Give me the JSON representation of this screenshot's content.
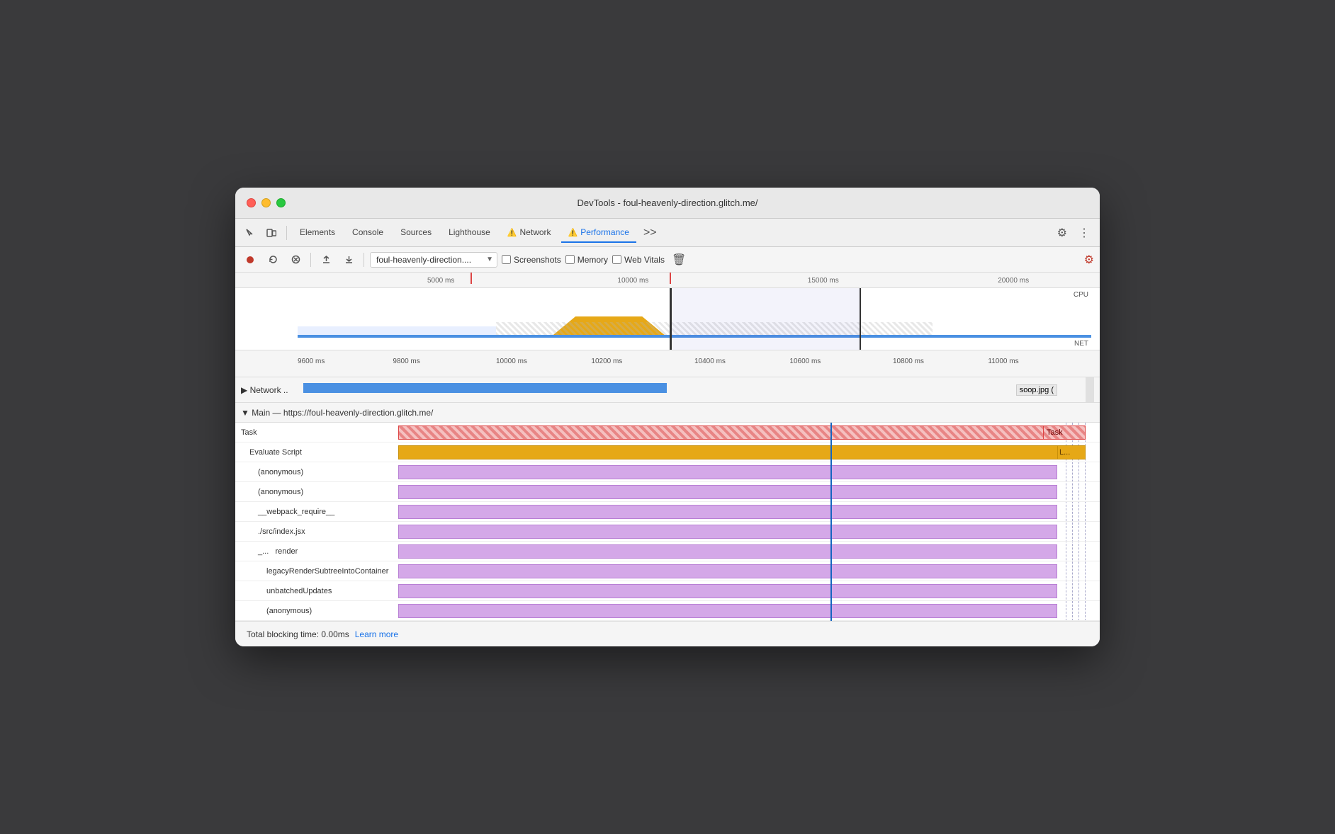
{
  "window": {
    "title": "DevTools - foul-heavenly-direction.glitch.me/"
  },
  "tabs": {
    "elements": "Elements",
    "console": "Console",
    "sources": "Sources",
    "lighthouse": "Lighthouse",
    "network": "Network",
    "performance": "Performance",
    "more": ">>"
  },
  "toolbar": {
    "url_value": "foul-heavenly-direction....",
    "screenshots_label": "Screenshots",
    "memory_label": "Memory",
    "web_vitals_label": "Web Vitals"
  },
  "timeline": {
    "ruler_marks": [
      "5000 ms",
      "10000 ms",
      "15000 ms",
      "20000 ms"
    ],
    "lower_marks": [
      "9600 ms",
      "9800 ms",
      "10000 ms",
      "10200 ms",
      "10400 ms",
      "10600 ms",
      "10800 ms",
      "11000 ms"
    ],
    "cpu_label": "CPU",
    "net_label": "NET"
  },
  "network_row": {
    "label": "▶ Network ..",
    "soop_label": "soop.jpg ("
  },
  "main_section": {
    "header": "▼ Main — https://foul-heavenly-direction.glitch.me/",
    "rows": [
      {
        "label": "Task",
        "bar_type": "task",
        "bar_right_label": "Task"
      },
      {
        "label": "Evaluate Script",
        "bar_type": "evaluate",
        "bar_right_label": "L..."
      },
      {
        "label": "(anonymous)",
        "bar_type": "purple",
        "indent": 1
      },
      {
        "label": "(anonymous)",
        "bar_type": "purple",
        "indent": 1
      },
      {
        "label": "__webpack_require__",
        "bar_type": "purple",
        "indent": 1
      },
      {
        "label": "./src/index.jsx",
        "bar_type": "purple",
        "indent": 1
      },
      {
        "label": "_...   render",
        "bar_type": "purple",
        "indent": 1
      },
      {
        "label": "legacyRenderSubtreeIntoContainer",
        "bar_type": "purple",
        "indent": 2
      },
      {
        "label": "unbatchedUpdates",
        "bar_type": "purple",
        "indent": 2
      },
      {
        "label": "(anonymous)",
        "bar_type": "purple",
        "indent": 2
      }
    ]
  },
  "status": {
    "tbt_label": "Total blocking time: 0.00ms",
    "learn_more": "Learn more"
  }
}
